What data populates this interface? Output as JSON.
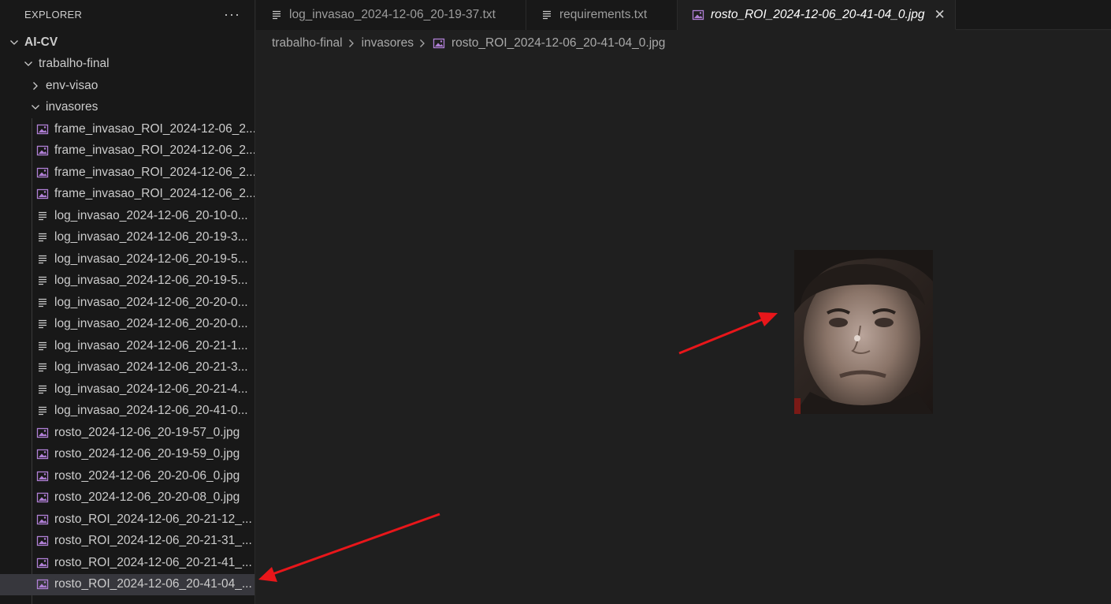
{
  "explorer": {
    "title": "EXPLORER",
    "more_label": "···"
  },
  "tree": {
    "root": "AI-CV",
    "folder_trabalho": "trabalho-final",
    "folder_env": "env-visao",
    "folder_invasores": "invasores",
    "files": [
      {
        "label": "frame_invasao_ROI_2024-12-06_2...",
        "type": "image"
      },
      {
        "label": "frame_invasao_ROI_2024-12-06_2...",
        "type": "image"
      },
      {
        "label": "frame_invasao_ROI_2024-12-06_2...",
        "type": "image"
      },
      {
        "label": "frame_invasao_ROI_2024-12-06_2...",
        "type": "image"
      },
      {
        "label": "log_invasao_2024-12-06_20-10-0...",
        "type": "text"
      },
      {
        "label": "log_invasao_2024-12-06_20-19-3...",
        "type": "text"
      },
      {
        "label": "log_invasao_2024-12-06_20-19-5...",
        "type": "text"
      },
      {
        "label": "log_invasao_2024-12-06_20-19-5...",
        "type": "text"
      },
      {
        "label": "log_invasao_2024-12-06_20-20-0...",
        "type": "text"
      },
      {
        "label": "log_invasao_2024-12-06_20-20-0...",
        "type": "text"
      },
      {
        "label": "log_invasao_2024-12-06_20-21-1...",
        "type": "text"
      },
      {
        "label": "log_invasao_2024-12-06_20-21-3...",
        "type": "text"
      },
      {
        "label": "log_invasao_2024-12-06_20-21-4...",
        "type": "text"
      },
      {
        "label": "log_invasao_2024-12-06_20-41-0...",
        "type": "text"
      },
      {
        "label": "rosto_2024-12-06_20-19-57_0.jpg",
        "type": "image"
      },
      {
        "label": "rosto_2024-12-06_20-19-59_0.jpg",
        "type": "image"
      },
      {
        "label": "rosto_2024-12-06_20-20-06_0.jpg",
        "type": "image"
      },
      {
        "label": "rosto_2024-12-06_20-20-08_0.jpg",
        "type": "image"
      },
      {
        "label": "rosto_ROI_2024-12-06_20-21-12_...",
        "type": "image"
      },
      {
        "label": "rosto_ROI_2024-12-06_20-21-31_...",
        "type": "image"
      },
      {
        "label": "rosto_ROI_2024-12-06_20-21-41_...",
        "type": "image"
      },
      {
        "label": "rosto_ROI_2024-12-06_20-41-04_...",
        "type": "image",
        "selected": true
      }
    ]
  },
  "tabs": [
    {
      "label": "log_invasao_2024-12-06_20-19-37.txt",
      "type": "text"
    },
    {
      "label": "requirements.txt",
      "type": "text"
    },
    {
      "label": "rosto_ROI_2024-12-06_20-41-04_0.jpg",
      "type": "image",
      "active": true,
      "close": "✕"
    }
  ],
  "breadcrumb": {
    "part1": "trabalho-final",
    "part2": "invasores",
    "part3": "rosto_ROI_2024-12-06_20-41-04_0.jpg"
  },
  "colors": {
    "annotation_arrow": "#e8161a",
    "image_icon": "#b180d7",
    "selected_row": "#37373d"
  },
  "icons": {
    "image_file": "image-file-icon",
    "text_file": "text-file-icon",
    "chevron_down": "chevron-down-icon",
    "chevron_right": "chevron-right-icon"
  }
}
